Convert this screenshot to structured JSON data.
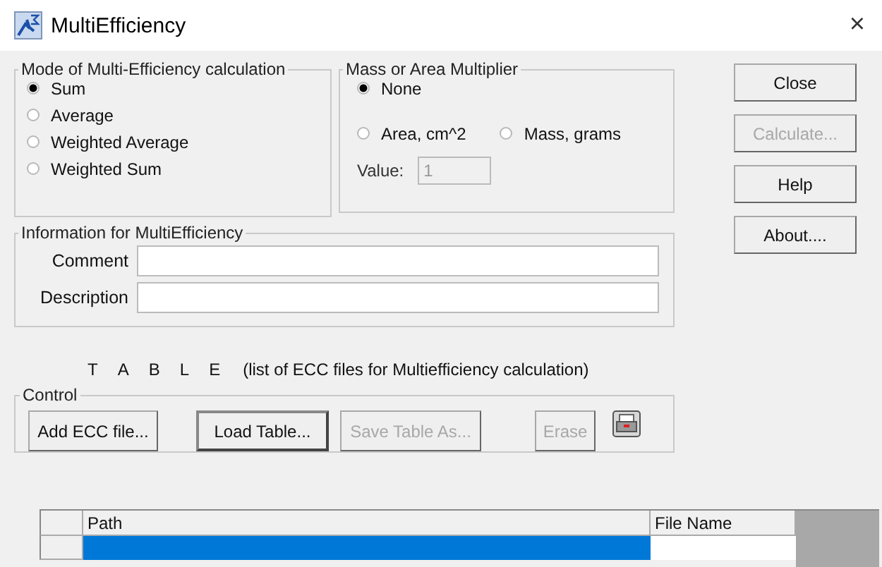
{
  "window": {
    "title": "MultiEfficiency",
    "close": "×"
  },
  "mode": {
    "title": "Mode of Multi-Efficiency calculation",
    "options": [
      {
        "label": "Sum",
        "selected": true
      },
      {
        "label": "Average",
        "selected": false
      },
      {
        "label": "Weighted Average",
        "selected": false
      },
      {
        "label": "Weighted Sum",
        "selected": false
      }
    ]
  },
  "multiplier": {
    "title": "Mass or Area Multiplier",
    "options": [
      {
        "label": "None",
        "selected": true
      },
      {
        "label": "Area, cm^2",
        "selected": false
      },
      {
        "label": "Mass, grams",
        "selected": false
      }
    ],
    "value_label": "Value:",
    "value": "1",
    "value_disabled": true
  },
  "side_buttons": [
    {
      "label": "Close",
      "disabled": false
    },
    {
      "label": "Calculate...",
      "disabled": true
    },
    {
      "label": "Help",
      "disabled": false
    },
    {
      "label": "About....",
      "disabled": false
    }
  ],
  "info": {
    "title": "Information for MultiEfficiency",
    "fields": [
      {
        "label": "Comment"
      },
      {
        "label": "Description"
      }
    ]
  },
  "table_caption": {
    "letters": [
      "T",
      "A",
      "B",
      "L",
      "E"
    ],
    "note": "(list of ECC files for Multiefficiency calculation)"
  },
  "control": {
    "title": "Control",
    "buttons": [
      {
        "label": "Add ECC file...",
        "disabled": false,
        "kind": "text"
      },
      {
        "label": "Load Table...",
        "disabled": false,
        "kind": "text",
        "default": true
      },
      {
        "label": "Save Table As...",
        "disabled": true,
        "kind": "text"
      },
      {
        "label": "Erase",
        "disabled": true,
        "kind": "text"
      },
      {
        "kind": "icon",
        "disabled": false
      }
    ]
  },
  "table": {
    "columns": [
      "Path",
      "File Name"
    ],
    "rows": [
      {
        "selected": true
      }
    ]
  }
}
